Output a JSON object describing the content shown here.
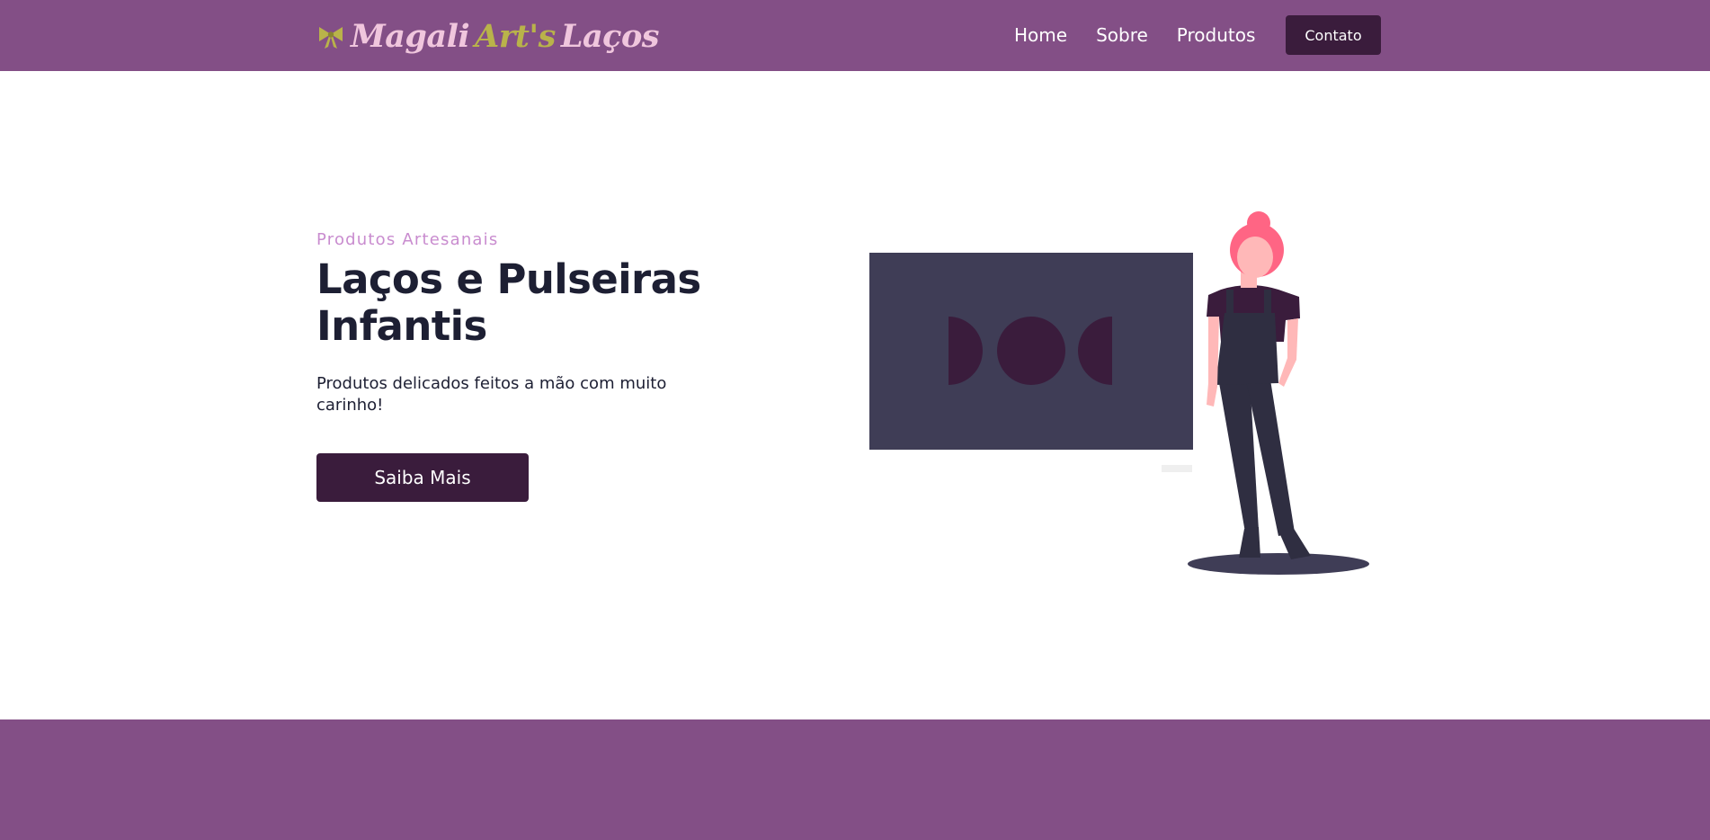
{
  "brand": {
    "part1": "Magali",
    "part2": "Art's",
    "part3": "Laços",
    "icon": "bow-icon"
  },
  "nav": {
    "items": [
      {
        "label": "Home"
      },
      {
        "label": "Sobre"
      },
      {
        "label": "Produtos"
      }
    ],
    "cta_label": "Contato"
  },
  "hero": {
    "eyebrow": "Produtos Artesanais",
    "headline_line1": "Laços e Pulseiras",
    "headline_line2": "Infantis",
    "subtext": "Produtos delicados feitos a mão com muito carinho!",
    "button_label": "Saiba Mais"
  },
  "colors": {
    "primary": "#834f86",
    "dark_accent": "#3a1c3c",
    "eyebrow": "#c98ccf",
    "heading": "#1d1f33",
    "logo_light": "#f0c6dd",
    "logo_olive": "#b9b34a"
  }
}
